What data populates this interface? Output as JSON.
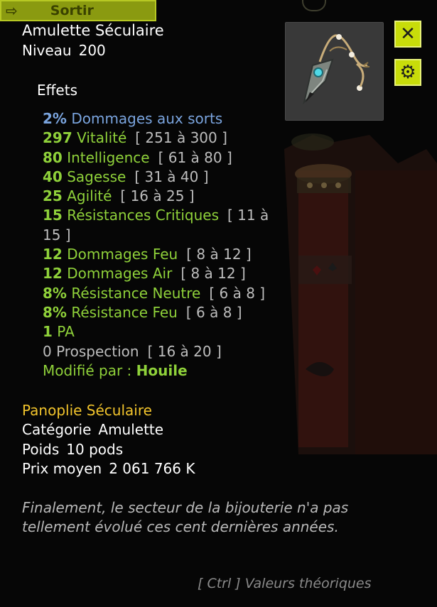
{
  "topbar": {
    "exit_label": "Sortir"
  },
  "item": {
    "name": "Amulette Séculaire",
    "level_label": "Niveau",
    "level_value": "200"
  },
  "buttons": {
    "close_icon": "close-icon",
    "settings_icon": "gear-icon"
  },
  "effects": {
    "title": "Effets",
    "list": [
      {
        "value": "2%",
        "name": "Dommages aux sorts",
        "range": ""
      },
      {
        "value": "297",
        "name": "Vitalité",
        "range": "[ 251 à 300 ]"
      },
      {
        "value": "80",
        "name": "Intelligence",
        "range": "[ 61 à 80 ]"
      },
      {
        "value": "40",
        "name": "Sagesse",
        "range": "[ 31 à 40 ]"
      },
      {
        "value": "25",
        "name": "Agilité",
        "range": "[ 16 à 25 ]"
      },
      {
        "value": "15",
        "name": "Résistances Critiques",
        "range": "[ 11 à",
        "range2": "15 ]"
      },
      {
        "value": "12",
        "name": "Dommages Feu",
        "range": "[ 8 à 12 ]"
      },
      {
        "value": "12",
        "name": "Dommages Air",
        "range": "[ 8 à 12 ]"
      },
      {
        "value": "8%",
        "name": "Résistance Neutre",
        "range": "[ 6 à 8 ]"
      },
      {
        "value": "8%",
        "name": "Résistance Feu",
        "range": "[ 6 à 8 ]"
      },
      {
        "value": "1",
        "name": "PA",
        "range": ""
      },
      {
        "value": "0",
        "name": "Prospection",
        "range": "[ 16 à 20 ]"
      }
    ],
    "modified_label": "Modifié par :",
    "modified_by": "Houile"
  },
  "set_name": "Panoplie Séculaire",
  "props": {
    "category_label": "Catégorie",
    "category_value": "Amulette",
    "weight_label": "Poids",
    "weight_value": "10 pods",
    "price_label": "Prix moyen",
    "price_value": "2 061 766 K"
  },
  "description": "Finalement, le secteur de la bijouterie n'a pas tellement évolué ces cent dernières années.",
  "footer_hint": "[ Ctrl ] Valeurs théoriques",
  "colors": {
    "background": "#060606",
    "effect_green": "#8fd13a",
    "effect_blue": "#7aa4de",
    "set_gold": "#f2c42c",
    "button_lime": "#c8dc0a"
  }
}
